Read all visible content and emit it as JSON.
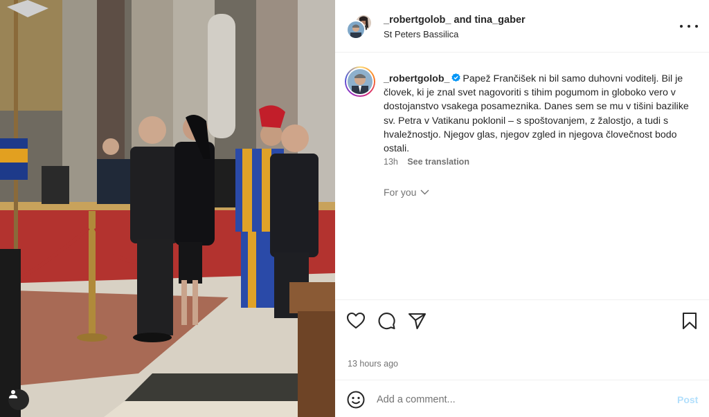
{
  "header": {
    "user1": "_robertgolob_",
    "joiner": "and",
    "user2": "tina_gaber",
    "location": "St Peters Bassilica"
  },
  "caption": {
    "username": "_robertgolob_",
    "text": "Papež Frančišek ni bil samo duhovni voditelj. Bil je človek, ki je znal svet nagovoriti s tihim pogumom in globoko vero v dostojanstvo vsakega posameznika. Danes sem se mu v tišini bazilike sv. Petra v Vatikanu poklonil – s spoštovanjem, z žalostjo, a tudi s hvaležnostjo. Njegov glas, njegov zgled in njegova človečnost bodo ostali.",
    "age": "13h",
    "see_translation": "See translation"
  },
  "for_you": "For you",
  "timestamp": "13 hours ago",
  "comment": {
    "placeholder": "Add a comment...",
    "post_label": "Post"
  },
  "colors": {
    "verified": "#0095f6",
    "post_disabled": "#b2dffc",
    "secondary_text": "#737373"
  },
  "icons": [
    "tag-user-icon",
    "more-options-icon",
    "verified-icon",
    "chevron-down-icon",
    "heart-icon",
    "comment-icon",
    "share-icon",
    "bookmark-icon",
    "emoji-icon"
  ]
}
